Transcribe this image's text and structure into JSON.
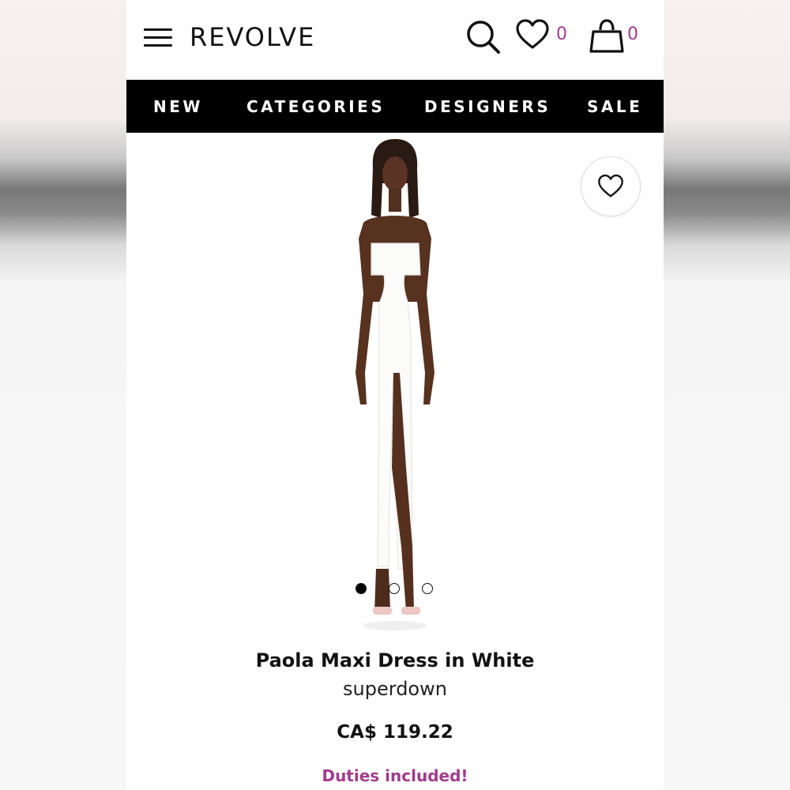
{
  "header": {
    "logo": "REVOLVE",
    "wishlist_count": "0",
    "cart_count": "0"
  },
  "nav": {
    "items": [
      "NEW",
      "CATEGORIES",
      "DESIGNERS",
      "SALE"
    ]
  },
  "product": {
    "title": "Paola Maxi Dress in White",
    "brand": "superdown",
    "price": "CA$ 119.22",
    "duties_note": "Duties included!",
    "image_count": 3,
    "active_image": 1
  },
  "colors": {
    "accent": "#a23b8c",
    "nav_bg": "#000000",
    "text": "#111111"
  },
  "icons": [
    "menu-icon",
    "search-icon",
    "heart-icon",
    "shopping-bag-icon",
    "heart-outline-icon"
  ]
}
